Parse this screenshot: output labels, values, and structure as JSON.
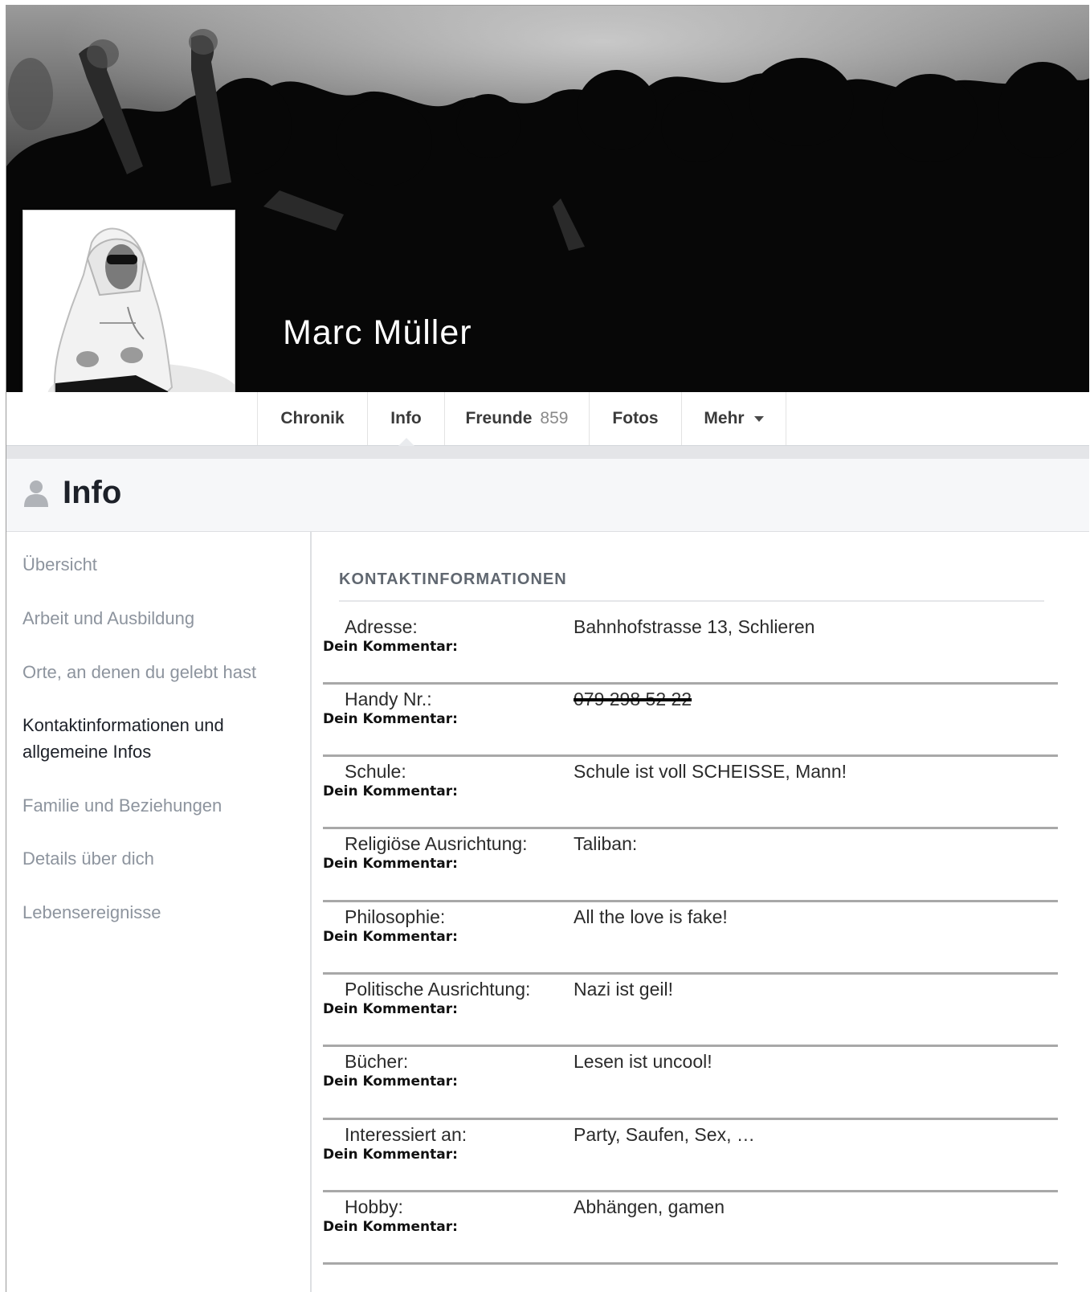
{
  "profile": {
    "name": "Marc Müller"
  },
  "nav": {
    "tabs": [
      {
        "label": "Chronik"
      },
      {
        "label": "Info",
        "active": true
      },
      {
        "label": "Freunde",
        "count": "859"
      },
      {
        "label": "Fotos"
      },
      {
        "label": "Mehr",
        "icon": "caret-down-icon"
      }
    ]
  },
  "info_header": {
    "title": "Info",
    "icon": "person-icon"
  },
  "sidebar": {
    "items": [
      {
        "label": "Übersicht"
      },
      {
        "label": "Arbeit und Ausbildung"
      },
      {
        "label": "Orte, an denen du gelebt hast"
      },
      {
        "label": "Kontaktinformationen und allgemeine Infos",
        "active": true
      },
      {
        "label": "Familie und Beziehungen"
      },
      {
        "label": "Details über dich"
      },
      {
        "label": "Lebensereignisse"
      }
    ]
  },
  "contact": {
    "section_title": "KONTAKTINFORMATIONEN",
    "comment_label": "Dein Kommentar:",
    "rows": [
      {
        "label": "Adresse:",
        "value": "Bahnhofstrasse 13, Schlieren"
      },
      {
        "label": "Handy Nr.:",
        "value": "079 298 52 22",
        "struck": true
      },
      {
        "label": "Schule:",
        "value": "Schule ist voll SCHEISSE, Mann!"
      },
      {
        "label": "Religiöse Ausrichtung:",
        "value": "Taliban:"
      },
      {
        "label": "Philosophie:",
        "value": "All the love is fake!"
      },
      {
        "label": "Politische Ausrichtung:",
        "value": "Nazi ist geil!"
      },
      {
        "label": "Bücher:",
        "value": "Lesen ist uncool!"
      },
      {
        "label": "Interessiert an:",
        "value": "Party, Saufen, Sex, …"
      },
      {
        "label": "Hobby:",
        "value": "Abhängen, gamen"
      }
    ]
  },
  "colors": {
    "nav_text": "#3a3a3a",
    "sidebar_inactive": "#8d949e",
    "sidebar_active": "#1d2129",
    "row_separator": "#a8a8a8"
  }
}
